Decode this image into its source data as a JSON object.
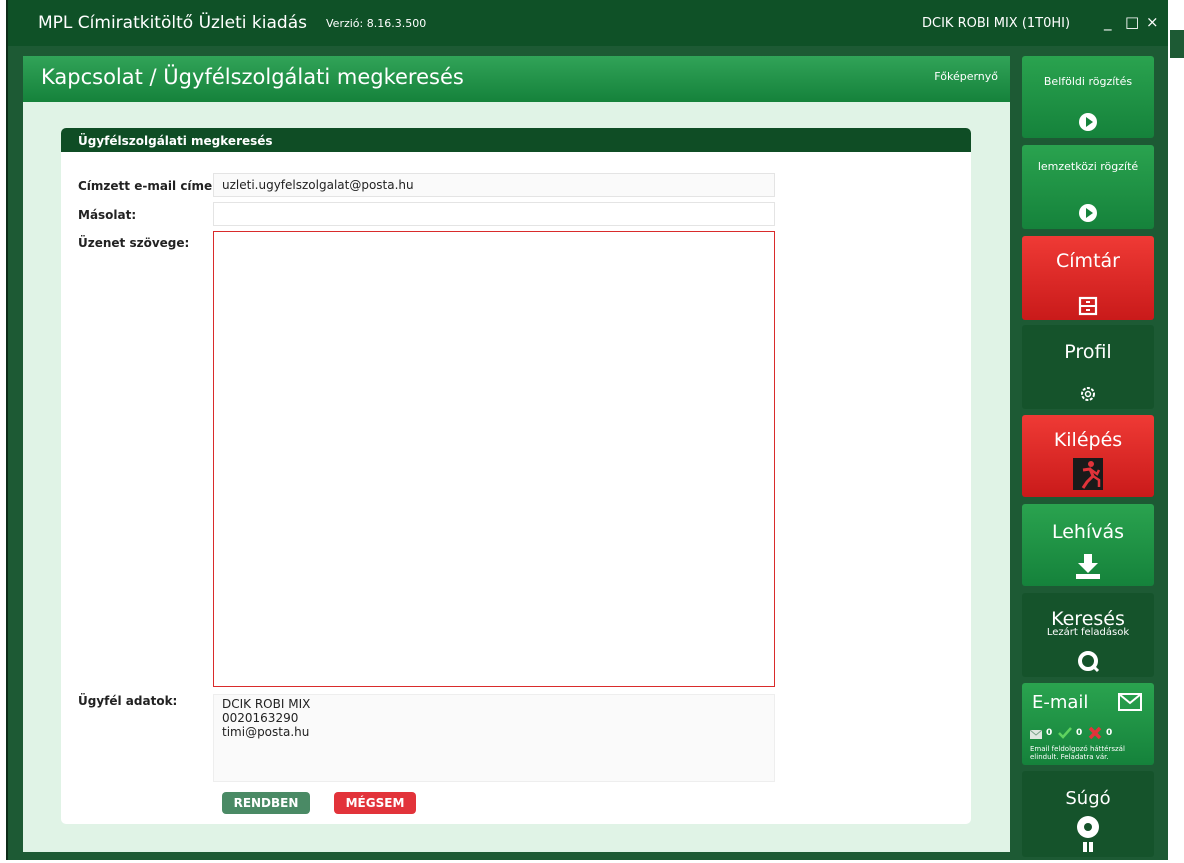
{
  "titlebar": {
    "app_title": "MPL Címiratkitöltő Üzleti kiadás",
    "version": "Verzió: 8.16.3.500",
    "user": "DCIK ROBI MIX (1T0HI)",
    "minimize": "_",
    "maximize": "□",
    "close": "×"
  },
  "header": {
    "title": "Kapcsolat / Ügyfélszolgálati megkeresés",
    "home_link": "Főképernyő"
  },
  "form": {
    "panel_title": "Ügyfélszolgálati megkeresés",
    "to_label": "Címzett e-mail címe:",
    "to_value": "uzleti.ugyfelszolgalat@posta.hu",
    "cc_label": "Másolat:",
    "cc_value": "",
    "message_label": "Üzenet szövege:",
    "message_value": "",
    "client_label": "Ügyfél adatok:",
    "client_lines": [
      "DCIK ROBI MIX",
      "0020163290",
      "timi@posta.hu"
    ],
    "ok_label": "RENDBEN",
    "cancel_label": "MÉGSEM"
  },
  "sidebar": {
    "domestic": "Belföldi rögzítés",
    "international": "lemzetközi rögzíté",
    "address_book": "Címtár",
    "profile": "Profil",
    "logout": "Kilépés",
    "download": "Lehívás",
    "search": "Keresés",
    "search_sub": "Lezárt feladások",
    "email": "E-mail",
    "email_counts": [
      "0",
      "0",
      "0"
    ],
    "email_note": "Email feldolgozó háttérszál elindult. Feladatra vár.",
    "help": "Súgó"
  },
  "colors": {
    "brand_green": "#15823b",
    "dark_green": "#0f5127",
    "red": "#e2333a"
  }
}
